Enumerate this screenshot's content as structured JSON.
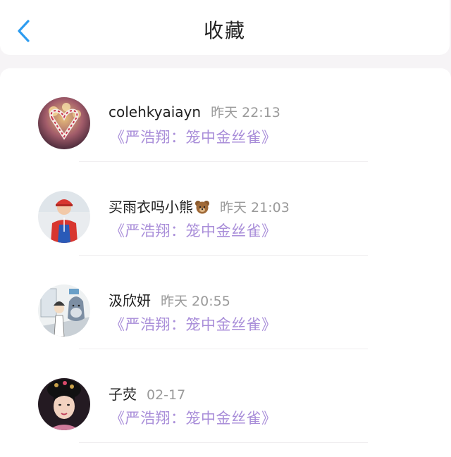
{
  "header": {
    "title": "收藏",
    "back_icon": "chevron-left-icon",
    "accent_color": "#2d9cf0"
  },
  "favorites": [
    {
      "username": "colehkyaiayn",
      "time": "昨天 22:13",
      "title": "《严浩翔：笼中金丝雀》",
      "emoji": ""
    },
    {
      "username": "买雨衣吗小熊",
      "time": "昨天 21:03",
      "title": "《严浩翔：笼中金丝雀》",
      "emoji": "bear-emoji-icon"
    },
    {
      "username": "汲欣妍",
      "time": "昨天 20:55",
      "title": "《严浩翔：笼中金丝雀》",
      "emoji": ""
    },
    {
      "username": "子荧",
      "time": "02-17",
      "title": "《严浩翔：笼中金丝雀》",
      "emoji": ""
    }
  ],
  "colors": {
    "title_purple": "#a98ed9",
    "time_gray": "#9a9a9a"
  }
}
